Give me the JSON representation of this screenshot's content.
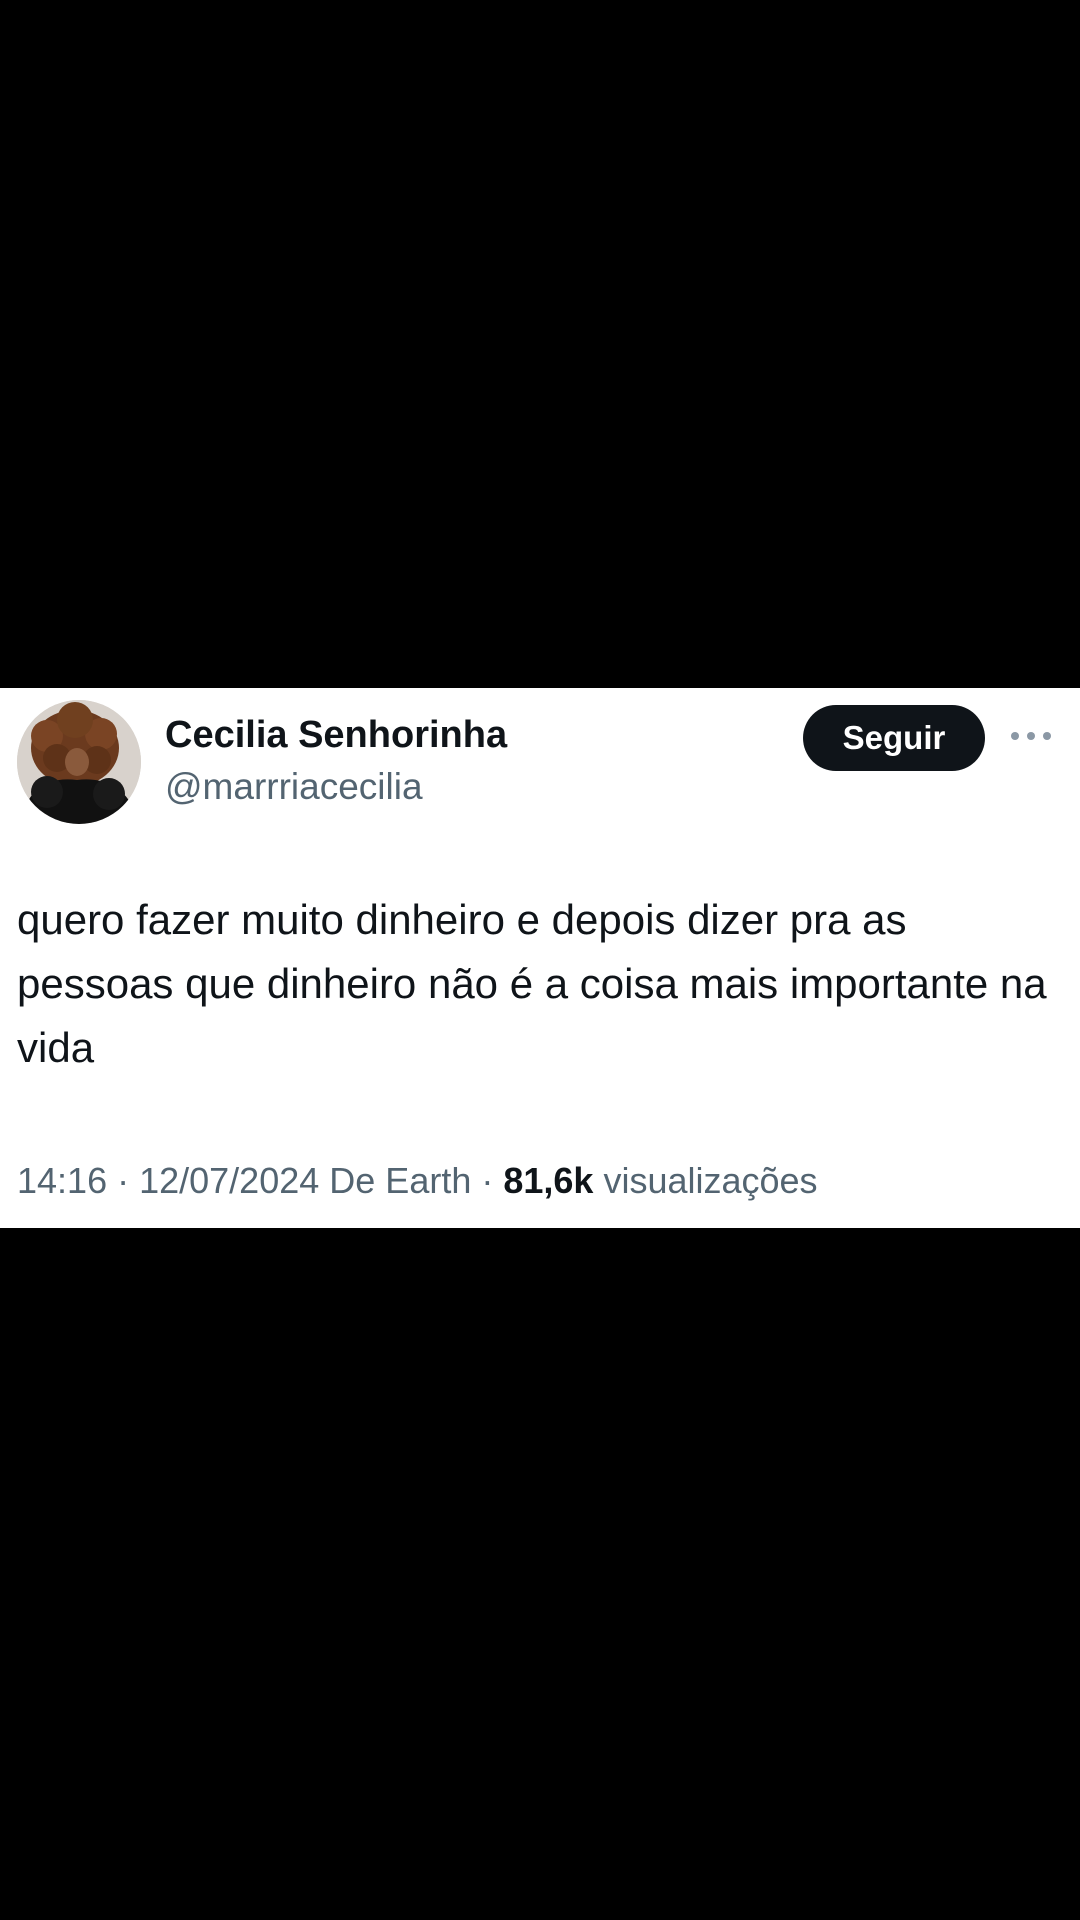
{
  "tweet": {
    "author": {
      "display_name": "Cecilia Senhorinha",
      "handle": "@marrriacecilia"
    },
    "follow_label": "Seguir",
    "more_icon": "ellipsis-icon",
    "text": "quero fazer muito dinheiro e depois dizer pra as pessoas que dinheiro não é a coisa mais importante na vida",
    "meta": {
      "time": "14:16",
      "separator": " · ",
      "date": "12/07/2024",
      "source": " De Earth",
      "views_count": "81,6k",
      "views_label": " visualizações"
    }
  },
  "colors": {
    "background": "#000000",
    "card": "#ffffff",
    "text_primary": "#0f1419",
    "text_secondary": "#536471",
    "follow_button_bg": "#0f1419"
  }
}
